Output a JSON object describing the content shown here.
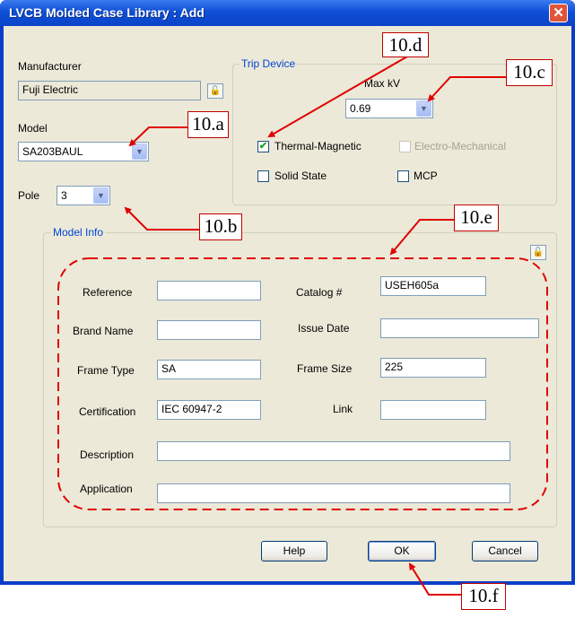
{
  "window": {
    "title": "LVCB Molded Case Library : Add",
    "close_glyph": "✕"
  },
  "manufacturer": {
    "label": "Manufacturer",
    "value": "Fuji Electric"
  },
  "model": {
    "label": "Model",
    "value": "SA203BAUL"
  },
  "pole": {
    "label": "Pole",
    "value": "3"
  },
  "trip_device": {
    "title": "Trip Device",
    "max_kv_label": "Max kV",
    "max_kv_value": "0.69",
    "options": [
      {
        "label": "Thermal-Magnetic",
        "checked": true,
        "enabled": true
      },
      {
        "label": "Electro-Mechanical",
        "checked": false,
        "enabled": false
      },
      {
        "label": "Solid State",
        "checked": false,
        "enabled": true
      },
      {
        "label": "MCP",
        "checked": false,
        "enabled": true
      }
    ]
  },
  "model_info": {
    "title": "Model Info",
    "reference": {
      "label": "Reference",
      "value": ""
    },
    "catalog": {
      "label": "Catalog #",
      "value": "USEH605a"
    },
    "brand_name": {
      "label": "Brand Name",
      "value": ""
    },
    "issue_date": {
      "label": "Issue Date",
      "value": ""
    },
    "frame_type": {
      "label": "Frame Type",
      "value": "SA"
    },
    "frame_size": {
      "label": "Frame Size",
      "value": "225"
    },
    "certification": {
      "label": "Certification",
      "value": "IEC 60947-2"
    },
    "link": {
      "label": "Link",
      "value": ""
    },
    "description": {
      "label": "Description",
      "value": ""
    },
    "application": {
      "label": "Application",
      "value": ""
    }
  },
  "buttons": {
    "help": "Help",
    "ok": "OK",
    "cancel": "Cancel"
  },
  "annotations": [
    "10.a",
    "10.b",
    "10.c",
    "10.d",
    "10.e",
    "10.f"
  ],
  "colors": {
    "title_bar": "#0a44c8",
    "dialog_bg": "#ece9d8",
    "group_title": "#0046d5",
    "annotation": "#e00000",
    "close": "#e0543a"
  },
  "icons": {
    "lock": "lock-icon",
    "dropdown": "chevron-down-icon",
    "check": "checkmark-icon"
  }
}
